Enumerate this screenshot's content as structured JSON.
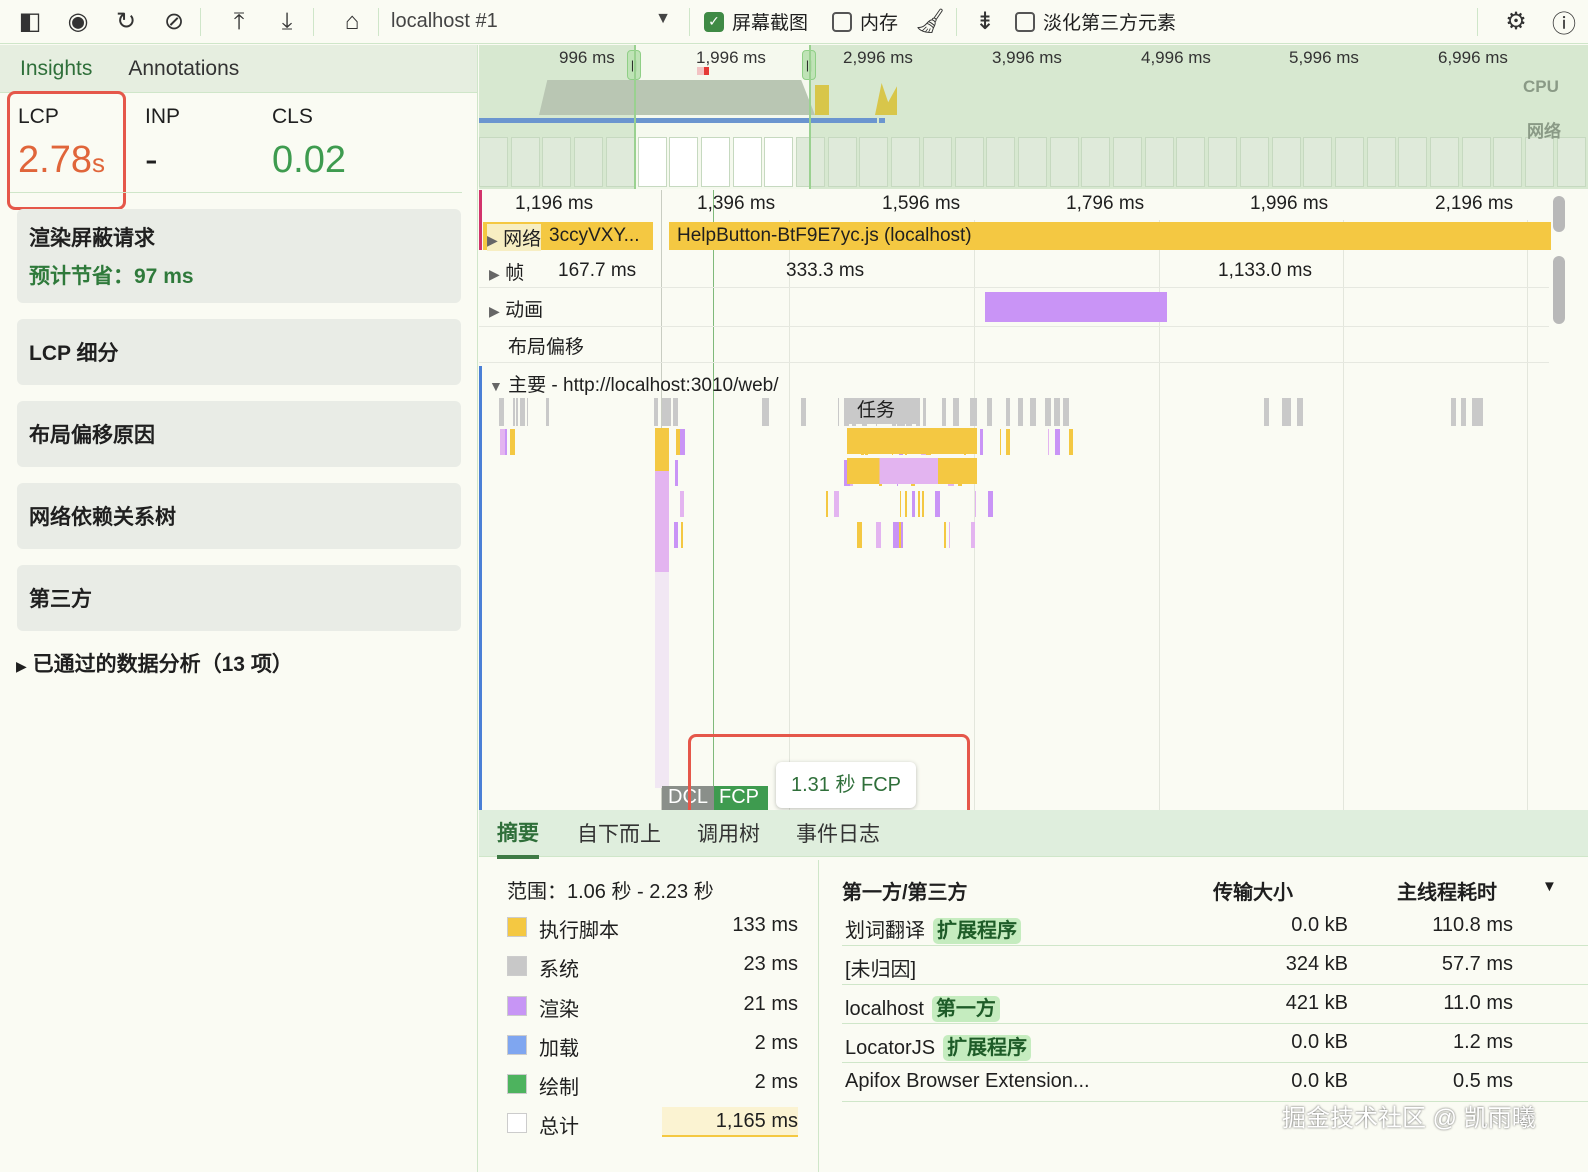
{
  "toolbar": {
    "icons": [
      "dock-panel-icon",
      "record-icon",
      "reload-icon",
      "clear-icon",
      "upload-icon",
      "download-icon",
      "home-icon"
    ],
    "target": "localhost #1",
    "screenshots_label": "屏幕截图",
    "screenshots_checked": true,
    "memory_label": "内存",
    "memory_checked": false,
    "third_party_label": "淡化第三方元素",
    "third_party_checked": false
  },
  "left": {
    "tabs": [
      "Insights",
      "Annotations"
    ],
    "metrics": [
      {
        "label": "LCP",
        "value": "2.78",
        "unit": "s",
        "color": "#e0653a"
      },
      {
        "label": "INP",
        "value": "-",
        "unit": "",
        "color": "#1f1f1f"
      },
      {
        "label": "CLS",
        "value": "0.02",
        "unit": "",
        "color": "#3e9b4f"
      }
    ],
    "render_blocking": {
      "title": "渲染屏蔽请求",
      "savings": "预计节省：97 ms"
    },
    "cards": [
      "LCP 细分",
      "布局偏移原因",
      "网络依赖关系树",
      "第三方"
    ],
    "passed": "已通过的数据分析（13 项）"
  },
  "overview": {
    "ticks": [
      "996 ms",
      "1,996 ms",
      "2,996 ms",
      "3,996 ms",
      "4,996 ms",
      "5,996 ms",
      "6,996 ms"
    ],
    "cpu_label": "CPU",
    "net_label": "网络"
  },
  "timeline": {
    "ticks": [
      "1,196 ms",
      "1,396 ms",
      "1,596 ms",
      "1,796 ms",
      "1,996 ms",
      "2,196 ms"
    ],
    "network_label": "网络",
    "network_req1": "3ccyVXY...",
    "network_req2": "HelpButton-BtF9E7yc.js (localhost)",
    "frames_label": "帧",
    "frames": [
      "167.7 ms",
      "333.3 ms",
      "1,133.0 ms"
    ],
    "animation_label": "动画",
    "layout_shift_label": "布局偏移",
    "main_label": "主要 - http://localhost:3010/web/",
    "task_label": "任务",
    "dcl": "DCL",
    "fcp": "FCP",
    "fcp_tooltip": "1.31 秒 FCP"
  },
  "bottom": {
    "tabs": [
      "摘要",
      "自下而上",
      "调用树",
      "事件日志"
    ],
    "range": "范围：1.06 秒 - 2.23 秒",
    "summary": [
      {
        "label": "执行脚本",
        "value": "133 ms",
        "color": "#f4c842"
      },
      {
        "label": "系统",
        "value": "23 ms",
        "color": "#c8c8c8"
      },
      {
        "label": "渲染",
        "value": "21 ms",
        "color": "#c795f5"
      },
      {
        "label": "加载",
        "value": "2 ms",
        "color": "#7fa6f0"
      },
      {
        "label": "绘制",
        "value": "2 ms",
        "color": "#4db35e"
      },
      {
        "label": "总计",
        "value": "1,165 ms",
        "color": "#ffffff"
      }
    ],
    "table_headers": [
      "第一方/第三方",
      "传输大小",
      "主线程耗时"
    ],
    "rows": [
      {
        "name": "划词翻译",
        "badge": "扩展程序",
        "size": "0.0 kB",
        "time": "110.8 ms"
      },
      {
        "name": "[未归因]",
        "badge": "",
        "size": "324 kB",
        "time": "57.7 ms"
      },
      {
        "name": "localhost",
        "badge": "第一方",
        "size": "421 kB",
        "time": "11.0 ms"
      },
      {
        "name": "LocatorJS",
        "badge": "扩展程序",
        "size": "0.0 kB",
        "time": "1.2 ms"
      },
      {
        "name": "Apifox Browser Extension...",
        "badge": "",
        "size": "0.0 kB",
        "time": "0.5 ms"
      }
    ],
    "watermark": "掘金技术社区 @ 凯雨曦"
  }
}
